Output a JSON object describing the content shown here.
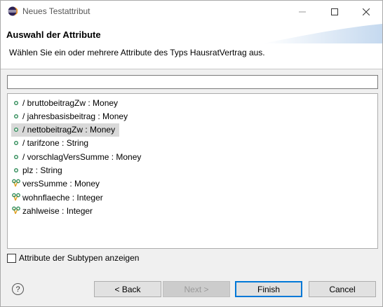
{
  "window": {
    "title": "Neues Testattribut"
  },
  "header": {
    "title": "Auswahl der Attribute",
    "description": "Wählen Sie ein oder mehrere Attribute des Typs HausratVertrag aus."
  },
  "filter": {
    "value": ""
  },
  "attributes": [
    {
      "label": "/ bruttobeitragZw : Money",
      "icon": "attribute-dot-icon",
      "selected": false
    },
    {
      "label": "/ jahresbasisbeitrag : Money",
      "icon": "attribute-dot-icon",
      "selected": false
    },
    {
      "label": "/ nettobeitragZw : Money",
      "icon": "attribute-dot-icon",
      "selected": true
    },
    {
      "label": "/ tarifzone : String",
      "icon": "attribute-dot-icon",
      "selected": false
    },
    {
      "label": "/ vorschlagVersSumme : Money",
      "icon": "attribute-dot-icon",
      "selected": false
    },
    {
      "label": "plz : String",
      "icon": "attribute-dot-icon",
      "selected": false
    },
    {
      "label": "versSumme : Money",
      "icon": "product-attribute-icon",
      "selected": false
    },
    {
      "label": "wohnflaeche : Integer",
      "icon": "product-attribute-icon",
      "selected": false
    },
    {
      "label": "zahlweise : Integer",
      "icon": "product-attribute-icon",
      "selected": false
    }
  ],
  "subtypes_checkbox": {
    "label": "Attribute der Subtypen anzeigen",
    "checked": false
  },
  "buttons": {
    "help": "?",
    "back": "< Back",
    "next": "Next >",
    "finish": "Finish",
    "cancel": "Cancel"
  },
  "colors": {
    "selection": "#d9d9d9",
    "default_button_border": "#0078d7",
    "attribute_icon": "#2e8b57"
  }
}
